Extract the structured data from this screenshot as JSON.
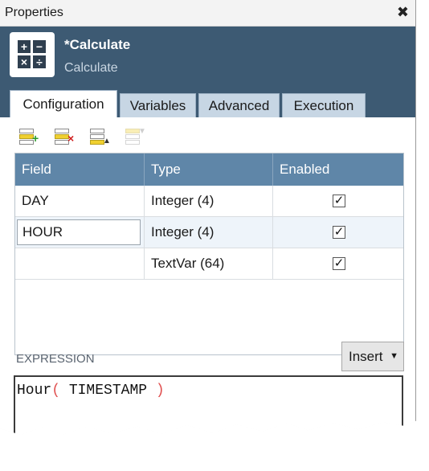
{
  "window": {
    "title": "Properties",
    "close_glyph": "✖"
  },
  "header": {
    "icon": "calculator-icon",
    "title": "*Calculate",
    "subtitle": "Calculate",
    "background": "#3d5a73"
  },
  "tabs": [
    {
      "label": "Configuration",
      "active": true
    },
    {
      "label": "Variables",
      "active": false
    },
    {
      "label": "Advanced",
      "active": false
    },
    {
      "label": "Execution",
      "active": false
    }
  ],
  "toolbar": {
    "buttons": [
      {
        "icon": "add-row-icon",
        "enabled": true
      },
      {
        "icon": "delete-row-icon",
        "enabled": true
      },
      {
        "icon": "sort-rows-icon",
        "enabled": true
      },
      {
        "icon": "filter-rows-icon",
        "enabled": false
      }
    ]
  },
  "grid": {
    "columns": [
      "Field",
      "Type",
      "Enabled"
    ],
    "rows": [
      {
        "field": "DAY",
        "type": "Integer (4)",
        "enabled": true
      },
      {
        "field": "HOUR",
        "type": "Integer (4)",
        "enabled": true
      },
      {
        "field": "",
        "type": "TextVar (64)",
        "enabled": true
      }
    ],
    "check_glyph": "✓",
    "header_color": "#5f86a8"
  },
  "expression": {
    "label": "EXPRESSION",
    "insert_label": "Insert",
    "caret": "▼",
    "code": {
      "func": "Hour",
      "open": "(",
      "arg": " TIMESTAMP ",
      "close": ")"
    }
  }
}
